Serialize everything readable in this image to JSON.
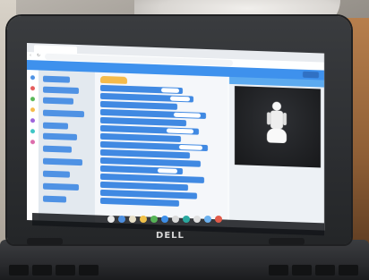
{
  "brand": {
    "logo_text": "DELL"
  }
}
